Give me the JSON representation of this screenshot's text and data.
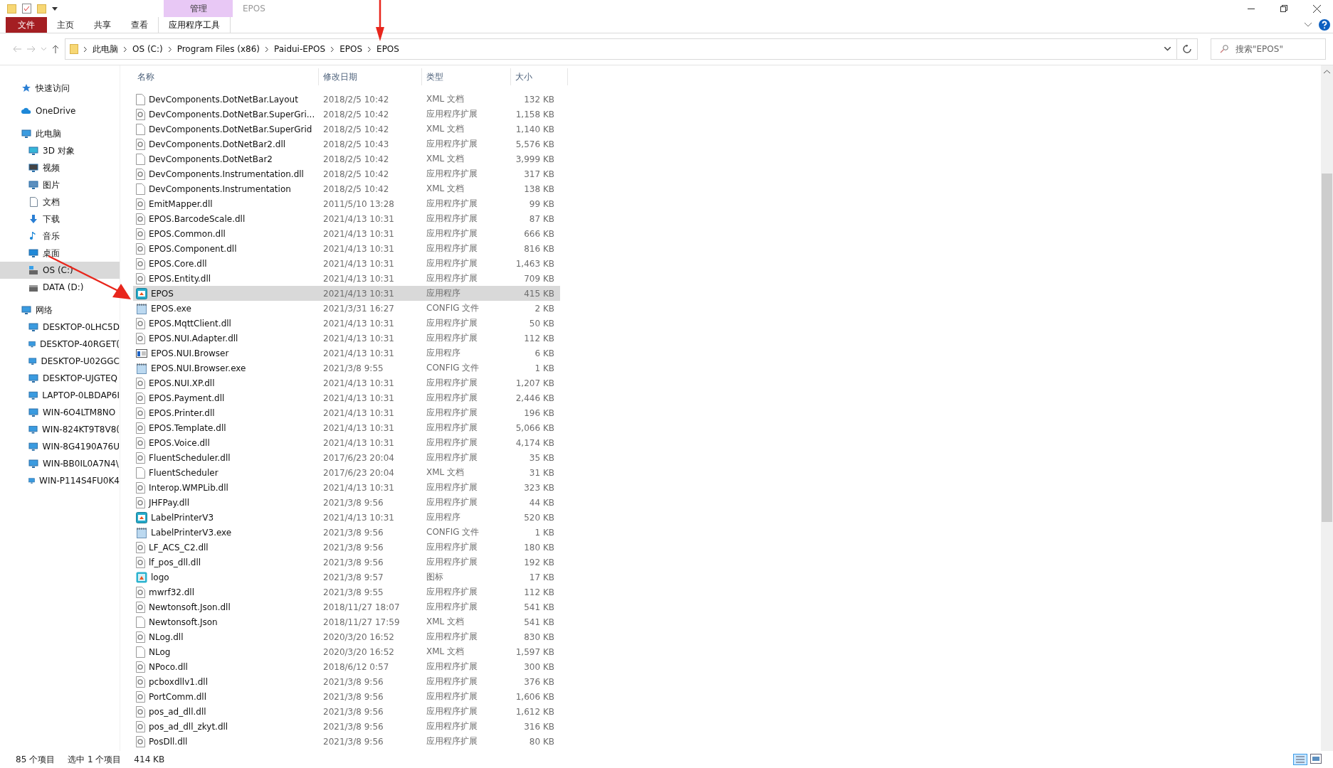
{
  "window": {
    "title": "EPOS",
    "context_tab_group": "管理"
  },
  "ribbon_tabs": [
    {
      "label": "文件",
      "kind": "file",
      "selected": false
    },
    {
      "label": "主页",
      "kind": "tab",
      "selected": false
    },
    {
      "label": "共享",
      "kind": "tab",
      "selected": false
    },
    {
      "label": "查看",
      "kind": "tab",
      "selected": false
    },
    {
      "label": "应用程序工具",
      "kind": "context",
      "selected": false
    }
  ],
  "address_bar": {
    "path": [
      "此电脑",
      "OS (C:)",
      "Program Files (x86)",
      "Paidui-EPOS",
      "EPOS",
      "EPOS"
    ]
  },
  "search": {
    "placeholder": "搜索\"EPOS\""
  },
  "sidebar": {
    "items": [
      {
        "label": "快速访问",
        "selected": false
      },
      {
        "label": "OneDrive",
        "selected": false
      },
      {
        "label": "此电脑",
        "selected": false,
        "children": [
          {
            "label": "3D 对象",
            "selected": false
          },
          {
            "label": "视频",
            "selected": false
          },
          {
            "label": "图片",
            "selected": false
          },
          {
            "label": "文档",
            "selected": false
          },
          {
            "label": "下载",
            "selected": false
          },
          {
            "label": "音乐",
            "selected": false
          },
          {
            "label": "桌面",
            "selected": false
          },
          {
            "label": "OS (C:)",
            "selected": true
          },
          {
            "label": "DATA (D:)",
            "selected": false
          }
        ]
      },
      {
        "label": "网络",
        "selected": false,
        "children": [
          {
            "label": "DESKTOP-0LHC5D",
            "selected": false
          },
          {
            "label": "DESKTOP-40RGET(",
            "selected": false
          },
          {
            "label": "DESKTOP-U02GGC",
            "selected": false
          },
          {
            "label": "DESKTOP-UJGTEQ",
            "selected": false
          },
          {
            "label": "LAPTOP-0LBDAP6I",
            "selected": false
          },
          {
            "label": "WIN-6O4LTM8NO",
            "selected": false
          },
          {
            "label": "WIN-824KT9T8V8(",
            "selected": false
          },
          {
            "label": "WIN-8G4190A76U",
            "selected": false
          },
          {
            "label": "WIN-BB0IL0A7N4\\",
            "selected": false
          },
          {
            "label": "WIN-P114S4FU0K4",
            "selected": false
          }
        ]
      }
    ]
  },
  "table": {
    "columns": [
      "名称",
      "修改日期",
      "类型",
      "大小"
    ],
    "rows": [
      {
        "name": "DevComponents.DotNetBar.Layout",
        "date": "2018/2/5 10:42",
        "type": "XML 文档",
        "size": "132 KB",
        "kind": "xml",
        "selected": false
      },
      {
        "name": "DevComponents.DotNetBar.SuperGri...",
        "date": "2018/2/5 10:42",
        "type": "应用程序扩展",
        "size": "1,158 KB",
        "kind": "dll",
        "selected": false
      },
      {
        "name": "DevComponents.DotNetBar.SuperGrid",
        "date": "2018/2/5 10:42",
        "type": "XML 文档",
        "size": "1,140 KB",
        "kind": "xml",
        "selected": false
      },
      {
        "name": "DevComponents.DotNetBar2.dll",
        "date": "2018/2/5 10:43",
        "type": "应用程序扩展",
        "size": "5,576 KB",
        "kind": "dll",
        "selected": false
      },
      {
        "name": "DevComponents.DotNetBar2",
        "date": "2018/2/5 10:42",
        "type": "XML 文档",
        "size": "3,999 KB",
        "kind": "xml",
        "selected": false
      },
      {
        "name": "DevComponents.Instrumentation.dll",
        "date": "2018/2/5 10:42",
        "type": "应用程序扩展",
        "size": "317 KB",
        "kind": "dll",
        "selected": false
      },
      {
        "name": "DevComponents.Instrumentation",
        "date": "2018/2/5 10:42",
        "type": "XML 文档",
        "size": "138 KB",
        "kind": "xml",
        "selected": false
      },
      {
        "name": "EmitMapper.dll",
        "date": "2011/5/10 13:28",
        "type": "应用程序扩展",
        "size": "99 KB",
        "kind": "dll",
        "selected": false
      },
      {
        "name": "EPOS.BarcodeScale.dll",
        "date": "2021/4/13 10:31",
        "type": "应用程序扩展",
        "size": "87 KB",
        "kind": "dll",
        "selected": false
      },
      {
        "name": "EPOS.Common.dll",
        "date": "2021/4/13 10:31",
        "type": "应用程序扩展",
        "size": "666 KB",
        "kind": "dll",
        "selected": false
      },
      {
        "name": "EPOS.Component.dll",
        "date": "2021/4/13 10:31",
        "type": "应用程序扩展",
        "size": "816 KB",
        "kind": "dll",
        "selected": false
      },
      {
        "name": "EPOS.Core.dll",
        "date": "2021/4/13 10:31",
        "type": "应用程序扩展",
        "size": "1,463 KB",
        "kind": "dll",
        "selected": false
      },
      {
        "name": "EPOS.Entity.dll",
        "date": "2021/4/13 10:31",
        "type": "应用程序扩展",
        "size": "709 KB",
        "kind": "dll",
        "selected": false
      },
      {
        "name": "EPOS",
        "date": "2021/4/13 10:31",
        "type": "应用程序",
        "size": "415 KB",
        "kind": "app",
        "selected": true
      },
      {
        "name": "EPOS.exe",
        "date": "2021/3/31 16:27",
        "type": "CONFIG 文件",
        "size": "2 KB",
        "kind": "config",
        "selected": false
      },
      {
        "name": "EPOS.MqttClient.dll",
        "date": "2021/4/13 10:31",
        "type": "应用程序扩展",
        "size": "50 KB",
        "kind": "dll",
        "selected": false
      },
      {
        "name": "EPOS.NUI.Adapter.dll",
        "date": "2021/4/13 10:31",
        "type": "应用程序扩展",
        "size": "112 KB",
        "kind": "dll",
        "selected": false
      },
      {
        "name": "EPOS.NUI.Browser",
        "date": "2021/4/13 10:31",
        "type": "应用程序",
        "size": "6 KB",
        "kind": "window",
        "selected": false
      },
      {
        "name": "EPOS.NUI.Browser.exe",
        "date": "2021/3/8 9:55",
        "type": "CONFIG 文件",
        "size": "1 KB",
        "kind": "config",
        "selected": false
      },
      {
        "name": "EPOS.NUI.XP.dll",
        "date": "2021/4/13 10:31",
        "type": "应用程序扩展",
        "size": "1,207 KB",
        "kind": "dll",
        "selected": false
      },
      {
        "name": "EPOS.Payment.dll",
        "date": "2021/4/13 10:31",
        "type": "应用程序扩展",
        "size": "2,446 KB",
        "kind": "dll",
        "selected": false
      },
      {
        "name": "EPOS.Printer.dll",
        "date": "2021/4/13 10:31",
        "type": "应用程序扩展",
        "size": "196 KB",
        "kind": "dll",
        "selected": false
      },
      {
        "name": "EPOS.Template.dll",
        "date": "2021/4/13 10:31",
        "type": "应用程序扩展",
        "size": "5,066 KB",
        "kind": "dll",
        "selected": false
      },
      {
        "name": "EPOS.Voice.dll",
        "date": "2021/4/13 10:31",
        "type": "应用程序扩展",
        "size": "4,174 KB",
        "kind": "dll",
        "selected": false
      },
      {
        "name": "FluentScheduler.dll",
        "date": "2017/6/23 20:04",
        "type": "应用程序扩展",
        "size": "35 KB",
        "kind": "dll",
        "selected": false
      },
      {
        "name": "FluentScheduler",
        "date": "2017/6/23 20:04",
        "type": "XML 文档",
        "size": "31 KB",
        "kind": "xml",
        "selected": false
      },
      {
        "name": "Interop.WMPLib.dll",
        "date": "2021/4/13 10:31",
        "type": "应用程序扩展",
        "size": "323 KB",
        "kind": "dll",
        "selected": false
      },
      {
        "name": "JHFPay.dll",
        "date": "2021/3/8 9:56",
        "type": "应用程序扩展",
        "size": "44 KB",
        "kind": "dll",
        "selected": false
      },
      {
        "name": "LabelPrinterV3",
        "date": "2021/4/13 10:31",
        "type": "应用程序",
        "size": "520 KB",
        "kind": "app",
        "selected": false
      },
      {
        "name": "LabelPrinterV3.exe",
        "date": "2021/3/8 9:56",
        "type": "CONFIG 文件",
        "size": "1 KB",
        "kind": "config",
        "selected": false
      },
      {
        "name": "LF_ACS_C2.dll",
        "date": "2021/3/8 9:56",
        "type": "应用程序扩展",
        "size": "180 KB",
        "kind": "dll",
        "selected": false
      },
      {
        "name": "lf_pos_dll.dll",
        "date": "2021/3/8 9:56",
        "type": "应用程序扩展",
        "size": "192 KB",
        "kind": "dll",
        "selected": false
      },
      {
        "name": "logo",
        "date": "2021/3/8 9:57",
        "type": "图标",
        "size": "17 KB",
        "kind": "icon",
        "selected": false
      },
      {
        "name": "mwrf32.dll",
        "date": "2021/3/8 9:55",
        "type": "应用程序扩展",
        "size": "112 KB",
        "kind": "dll",
        "selected": false
      },
      {
        "name": "Newtonsoft.Json.dll",
        "date": "2018/11/27 18:07",
        "type": "应用程序扩展",
        "size": "541 KB",
        "kind": "dll",
        "selected": false
      },
      {
        "name": "Newtonsoft.Json",
        "date": "2018/11/27 17:59",
        "type": "XML 文档",
        "size": "541 KB",
        "kind": "xml",
        "selected": false
      },
      {
        "name": "NLog.dll",
        "date": "2020/3/20 16:52",
        "type": "应用程序扩展",
        "size": "830 KB",
        "kind": "dll",
        "selected": false
      },
      {
        "name": "NLog",
        "date": "2020/3/20 16:52",
        "type": "XML 文档",
        "size": "1,597 KB",
        "kind": "xml",
        "selected": false
      },
      {
        "name": "NPoco.dll",
        "date": "2018/6/12 0:57",
        "type": "应用程序扩展",
        "size": "300 KB",
        "kind": "dll",
        "selected": false
      },
      {
        "name": "pcboxdllv1.dll",
        "date": "2021/3/8 9:56",
        "type": "应用程序扩展",
        "size": "376 KB",
        "kind": "dll",
        "selected": false
      },
      {
        "name": "PortComm.dll",
        "date": "2021/3/8 9:56",
        "type": "应用程序扩展",
        "size": "1,606 KB",
        "kind": "dll",
        "selected": false
      },
      {
        "name": "pos_ad_dll.dll",
        "date": "2021/3/8 9:56",
        "type": "应用程序扩展",
        "size": "1,612 KB",
        "kind": "dll",
        "selected": false
      },
      {
        "name": "pos_ad_dll_zkyt.dll",
        "date": "2021/3/8 9:56",
        "type": "应用程序扩展",
        "size": "316 KB",
        "kind": "dll",
        "selected": false
      },
      {
        "name": "PosDll.dll",
        "date": "2021/3/8 9:56",
        "type": "应用程序扩展",
        "size": "80 KB",
        "kind": "dll",
        "selected": false
      }
    ]
  },
  "status_bar": {
    "item_count": "85 个项目",
    "selection": "选中 1 个项目",
    "selection_size": "414 KB"
  }
}
